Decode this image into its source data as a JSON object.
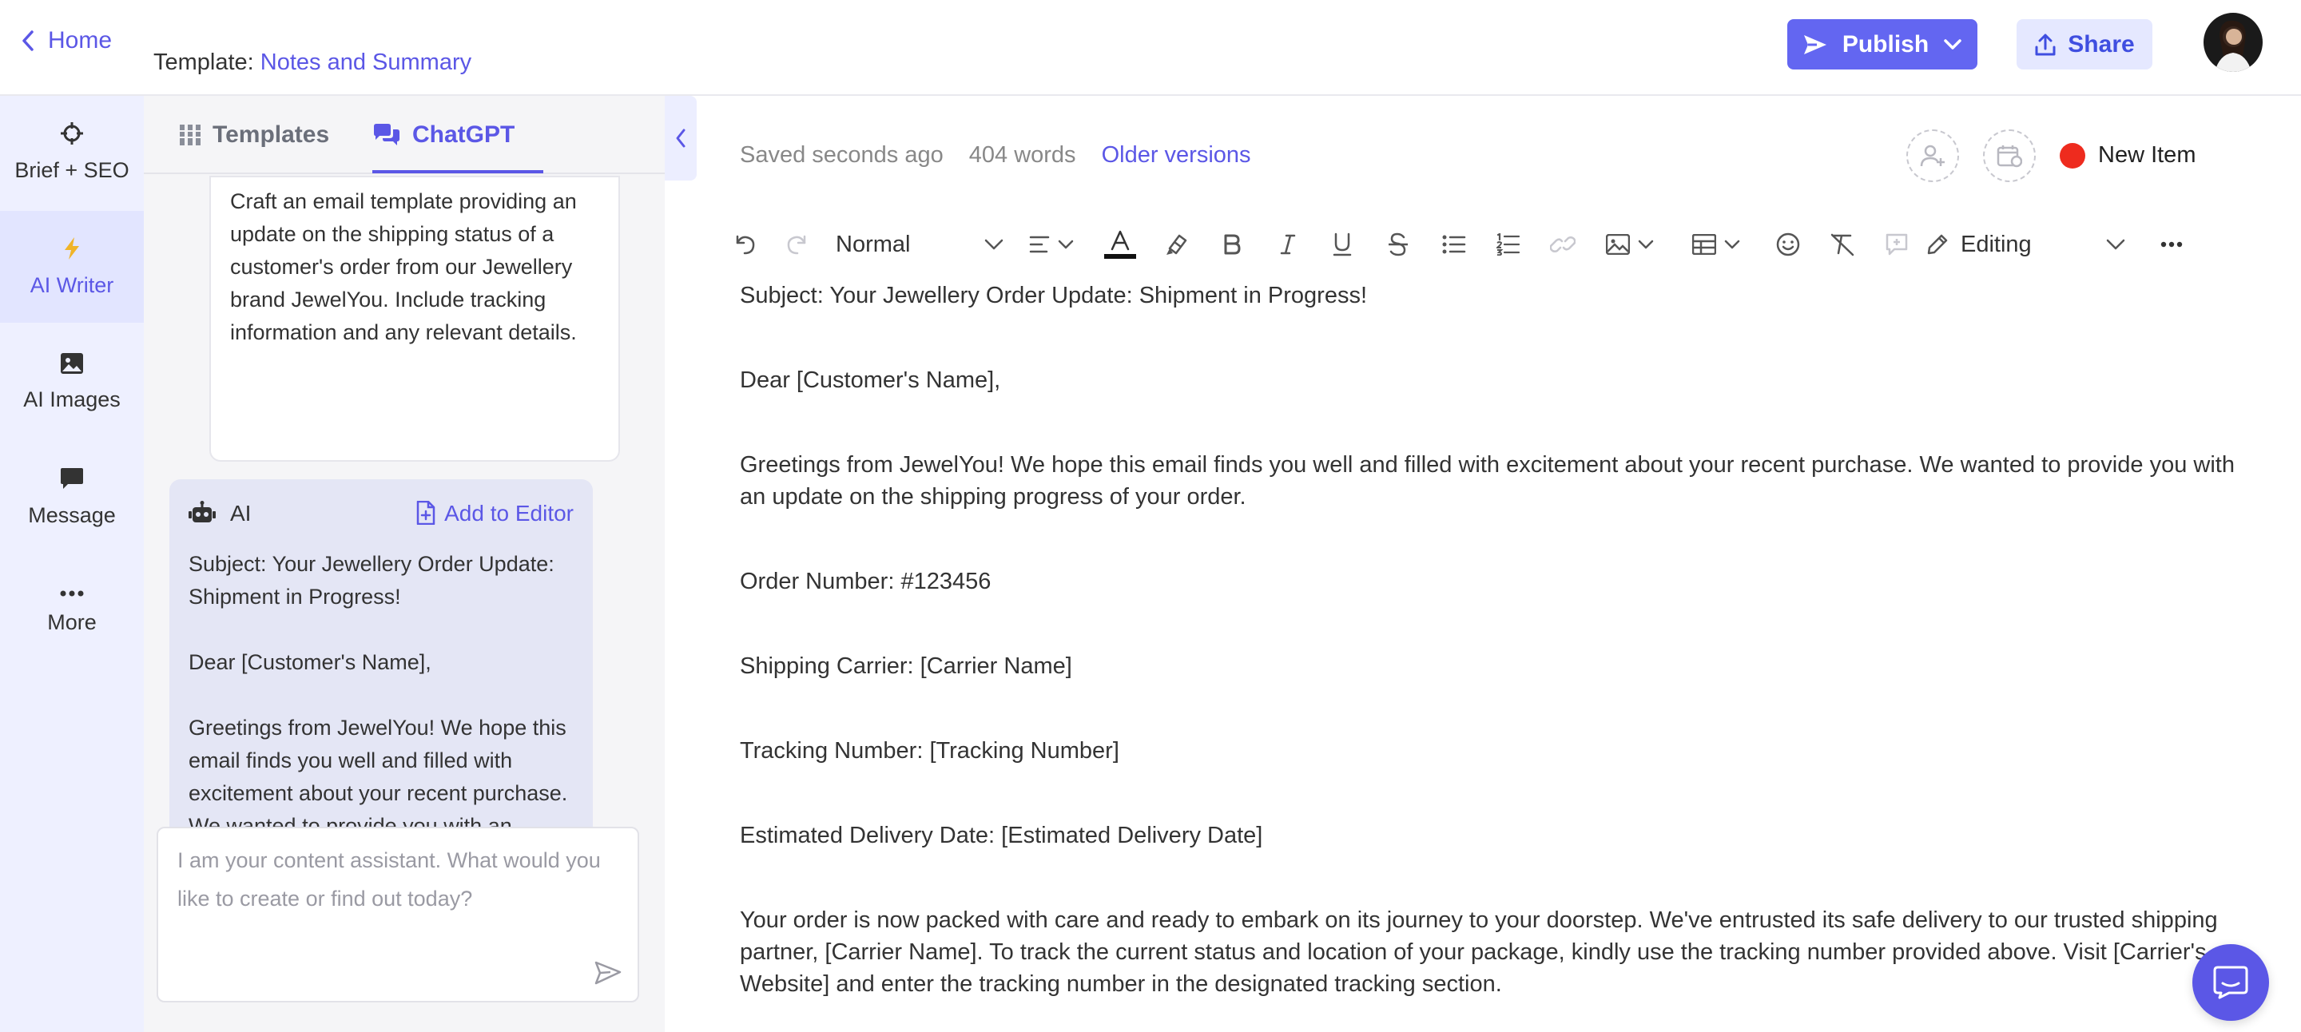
{
  "topbar": {
    "home_label": "Home",
    "template_prefix": "Template:",
    "template_name": "Notes and Summary",
    "publish_label": "Publish",
    "share_label": "Share"
  },
  "rail": {
    "items": [
      {
        "label": "Brief + SEO",
        "icon": "crosshair-icon"
      },
      {
        "label": "AI Writer",
        "icon": "lightning-icon"
      },
      {
        "label": "AI Images",
        "icon": "image-icon"
      },
      {
        "label": "Message",
        "icon": "message-icon"
      },
      {
        "label": "More",
        "icon": "more-icon"
      }
    ]
  },
  "panel": {
    "tabs": [
      {
        "label": "Templates",
        "icon": "columns-icon"
      },
      {
        "label": "ChatGPT",
        "icon": "chat-icon"
      }
    ],
    "prompt": "Craft an email template providing an update on the shipping status of a customer's order from our Jewellery brand JewelYou. Include tracking information and any relevant details.",
    "ai_card": {
      "label": "AI",
      "add_to_editor": "Add to Editor",
      "paragraphs": [
        "Subject: Your Jewellery Order Update: Shipment in Progress!",
        "Dear [Customer's Name],",
        "Greetings from JewelYou! We hope this email finds you well and filled with excitement about your recent purchase. We wanted to provide you with an update on the shipping progress of your order."
      ]
    },
    "input_placeholder": "I am your content assistant. What would you like to create or find out today?"
  },
  "editor": {
    "saved_status": "Saved seconds ago",
    "word_count": "404 words",
    "older_versions": "Older versions",
    "new_item": "New Item",
    "toolbar": {
      "style_select": "Normal",
      "mode": "Editing"
    },
    "document": [
      "Subject: Your Jewellery Order Update: Shipment in Progress!",
      "Dear [Customer's Name],",
      "Greetings from JewelYou! We hope this email finds you well and filled with excitement about your recent purchase. We wanted to provide you with an update on the shipping progress of your order.",
      "Order Number: #123456",
      "Shipping Carrier: [Carrier Name]",
      "Tracking Number: [Tracking Number]",
      "Estimated Delivery Date: [Estimated Delivery Date]",
      "Your order is now packed with care and ready to embark on its journey to your doorstep. We've entrusted its safe delivery to our trusted shipping partner, [Carrier Name]. To track the current status and location of your package, kindly use the tracking number provided above. Visit [Carrier's Website] and enter the tracking number in the designated tracking section."
    ]
  },
  "colors": {
    "accent": "#5b57e6",
    "publish_bg": "#6366f1",
    "share_bg": "#e5e8ff",
    "rail_bg": "#eef0ff",
    "status_dot": "#ee2b1e"
  }
}
